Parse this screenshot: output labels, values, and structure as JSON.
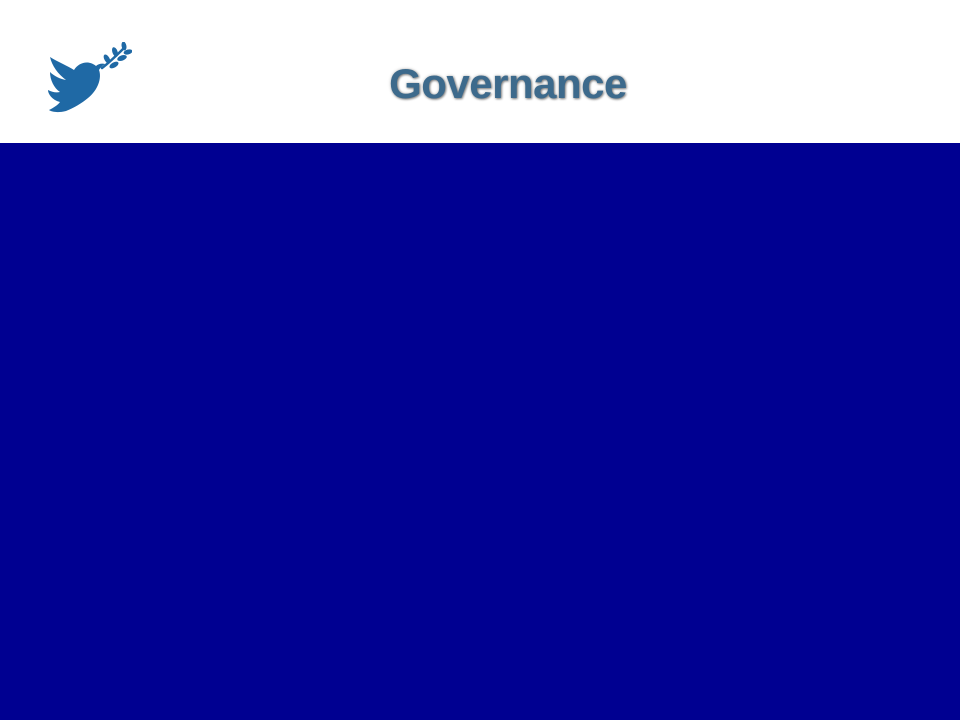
{
  "slide": {
    "title": "Governance",
    "logo_icon": "dove-with-olive-branch-icon",
    "colors": {
      "title_text": "#3d6a8c",
      "logo": "#1f69a5",
      "body_background": "#000091",
      "header_background": "#ffffff"
    }
  }
}
